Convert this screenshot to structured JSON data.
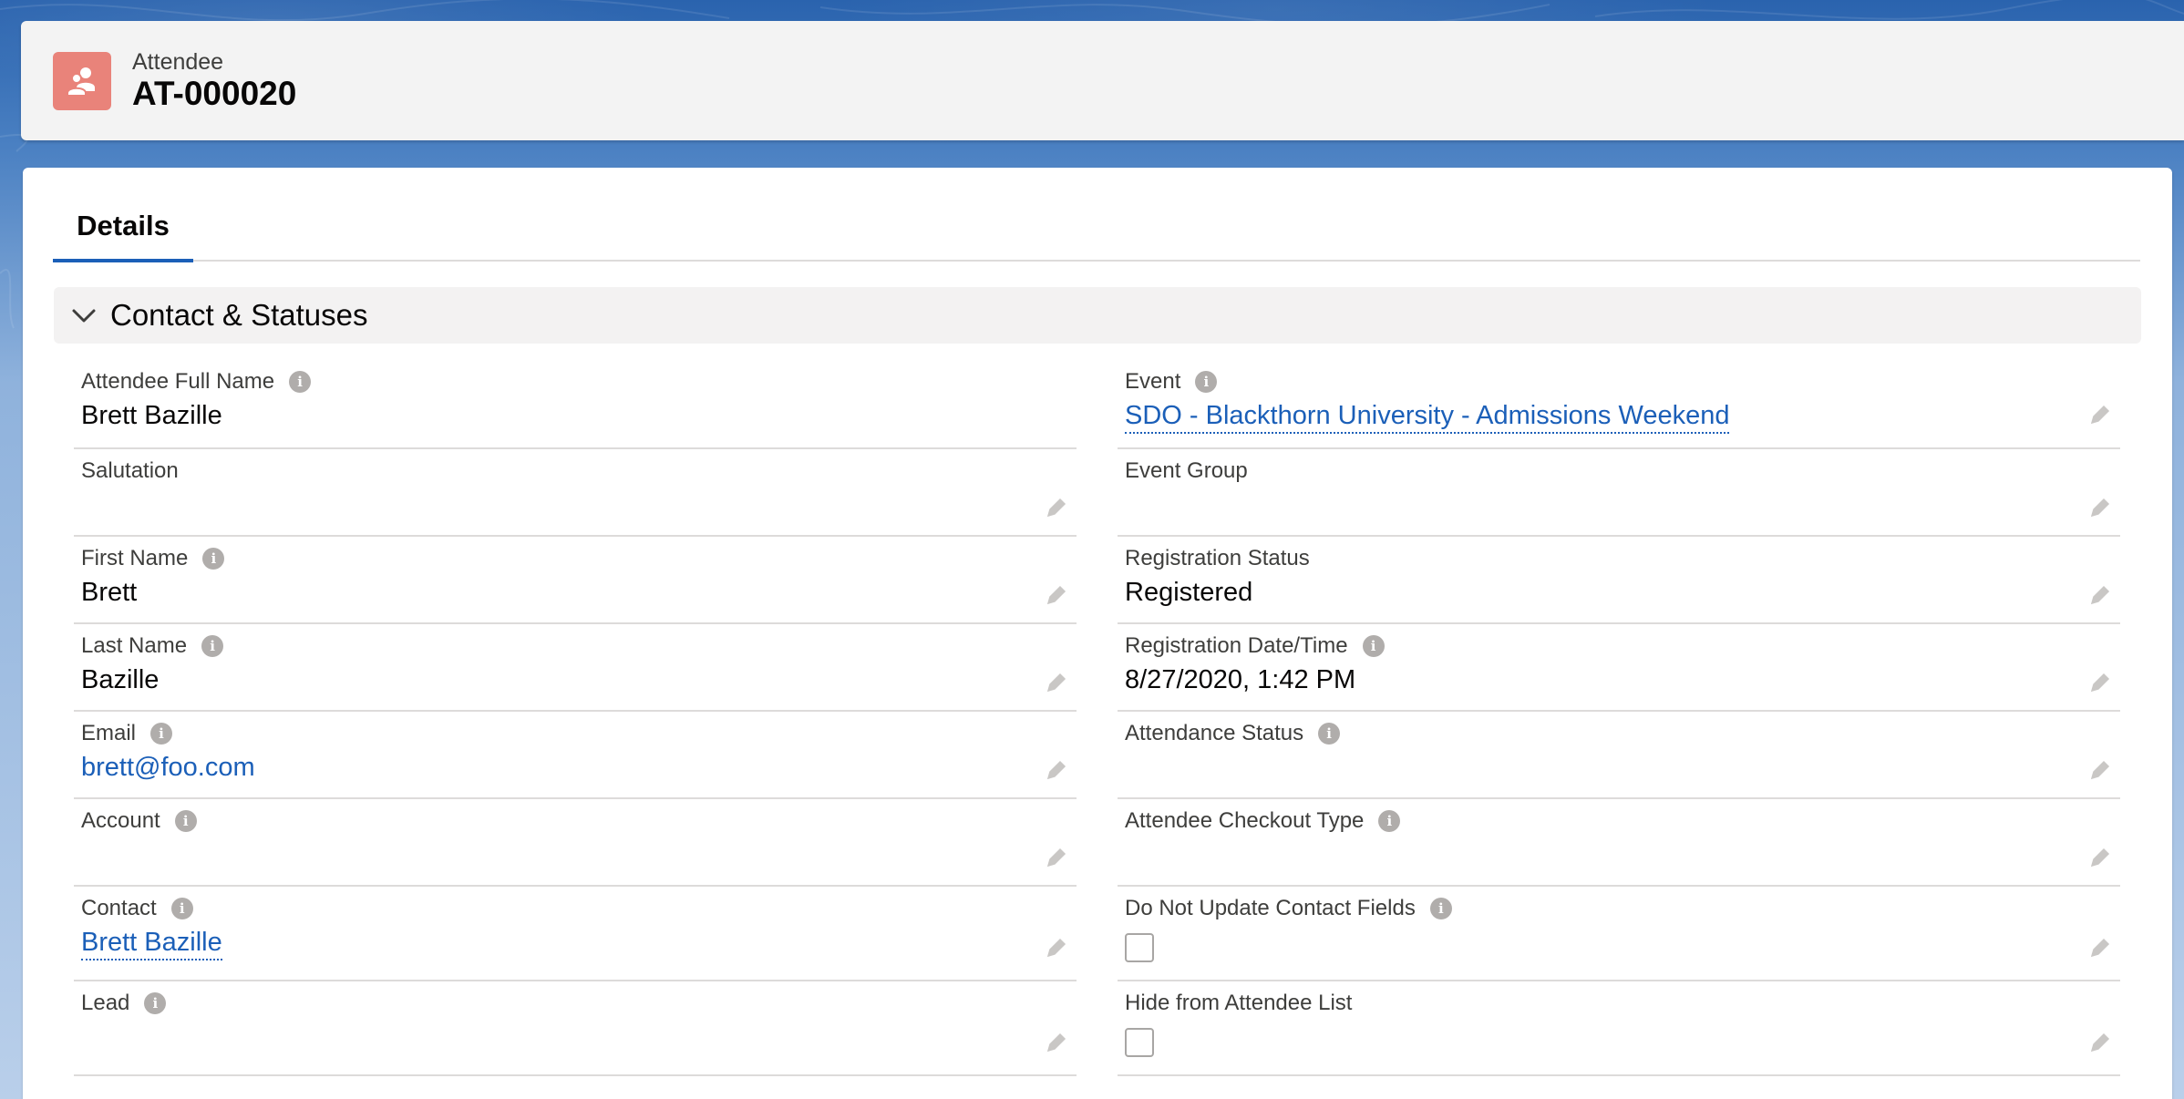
{
  "header": {
    "object_label": "Attendee",
    "record_name": "AT-000020",
    "icon": "attendee-people-icon",
    "icon_color": "#e9837a"
  },
  "tabs": [
    {
      "label": "Details",
      "active": true
    }
  ],
  "section": {
    "title": "Contact & Statuses",
    "expanded": true
  },
  "left_fields": [
    {
      "label": "Attendee Full Name",
      "value": "Brett Bazille",
      "info": true,
      "editable": false,
      "type": "text"
    },
    {
      "label": "Salutation",
      "value": "",
      "info": false,
      "editable": true,
      "type": "text"
    },
    {
      "label": "First Name",
      "value": "Brett",
      "info": true,
      "editable": true,
      "type": "text"
    },
    {
      "label": "Last Name",
      "value": "Bazille",
      "info": true,
      "editable": true,
      "type": "text"
    },
    {
      "label": "Email",
      "value": "brett@foo.com",
      "info": true,
      "editable": true,
      "type": "email"
    },
    {
      "label": "Account",
      "value": "",
      "info": true,
      "editable": true,
      "type": "lookup"
    },
    {
      "label": "Contact",
      "value": "Brett Bazille",
      "info": true,
      "editable": true,
      "type": "lookup"
    },
    {
      "label": "Lead",
      "value": "",
      "info": true,
      "editable": true,
      "type": "lookup"
    }
  ],
  "right_fields": [
    {
      "label": "Event",
      "value": "SDO - Blackthorn University - Admissions Weekend",
      "info": true,
      "editable": true,
      "type": "lookup"
    },
    {
      "label": "Event Group",
      "value": "",
      "info": false,
      "editable": true,
      "type": "lookup"
    },
    {
      "label": "Registration Status",
      "value": "Registered",
      "info": false,
      "editable": true,
      "type": "text"
    },
    {
      "label": "Registration Date/Time",
      "value": "8/27/2020, 1:42 PM",
      "info": true,
      "editable": true,
      "type": "text"
    },
    {
      "label": "Attendance Status",
      "value": "",
      "info": true,
      "editable": true,
      "type": "text"
    },
    {
      "label": "Attendee Checkout Type",
      "value": "",
      "info": true,
      "editable": true,
      "type": "text"
    },
    {
      "label": "Do Not Update Contact Fields",
      "value": false,
      "info": true,
      "editable": true,
      "type": "checkbox"
    },
    {
      "label": "Hide from Attendee List",
      "value": false,
      "info": false,
      "editable": true,
      "type": "checkbox"
    }
  ],
  "colors": {
    "link": "#1b5fb8",
    "brand_blue": "#1f5ba8"
  }
}
